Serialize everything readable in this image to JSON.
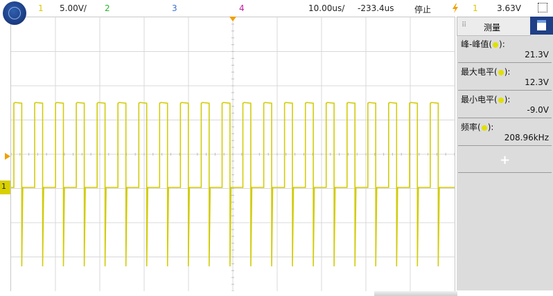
{
  "topbar": {
    "ch1_num": "1",
    "ch1_scale": "5.00V/",
    "ch2_num": "2",
    "ch3_num": "3",
    "ch4_num": "4",
    "timebase": "10.00us/",
    "delay": "-233.4us",
    "run_state": "停止",
    "trigger_icon": "lightning-trigger-icon",
    "trigger_ch": "1",
    "trigger_level": "3.63V",
    "colors": {
      "ch1": "#d4c800",
      "ch2": "#28b428",
      "ch3": "#3a6fd8",
      "ch4": "#c01c9c",
      "trigger": "#f0a000"
    }
  },
  "scope": {
    "trace_color": "#d2cc0c",
    "ch1_marker": "1",
    "pulse_count": 21,
    "high_level_v": 12.3,
    "low_level_v": -9.0
  },
  "panel": {
    "title": "测量",
    "measurements": [
      {
        "label": "峰-峰值",
        "value": "21.3V"
      },
      {
        "label": "最大电平",
        "value": "12.3V"
      },
      {
        "label": "最小电平",
        "value": "-9.0V"
      },
      {
        "label": "频率",
        "value": "208.96kHz"
      }
    ],
    "add_label": "+"
  }
}
